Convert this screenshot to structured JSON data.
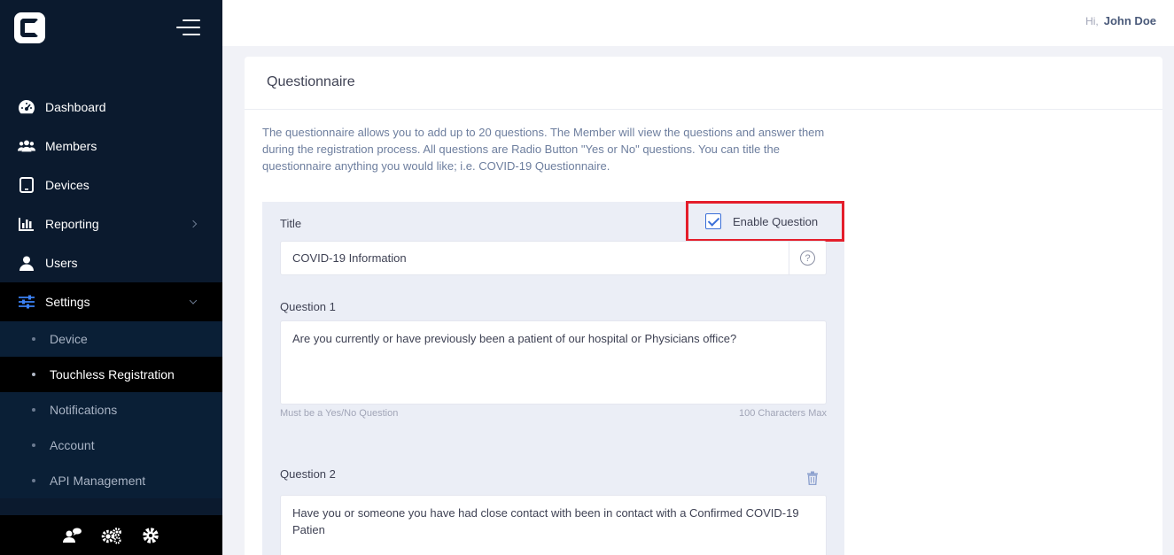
{
  "sidebar": {
    "nav": [
      {
        "label": "Dashboard",
        "icon": "dashboard-gauge-icon"
      },
      {
        "label": "Members",
        "icon": "members-group-icon"
      },
      {
        "label": "Devices",
        "icon": "tablet-device-icon"
      },
      {
        "label": "Reporting",
        "icon": "bar-chart-icon"
      },
      {
        "label": "Users",
        "icon": "user-icon"
      },
      {
        "label": "Settings",
        "icon": "sliders-icon"
      }
    ],
    "settings_sub": [
      {
        "label": "Device"
      },
      {
        "label": "Touchless Registration"
      },
      {
        "label": "Notifications"
      },
      {
        "label": "Account"
      },
      {
        "label": "API Management"
      }
    ],
    "active_sub": "Touchless Registration",
    "accent_color": "#3b82f6"
  },
  "topbar": {
    "greeting": "Hi,",
    "user_name": "John Doe"
  },
  "card": {
    "title": "Questionnaire",
    "description": "The questionnaire allows you to add up to 20 questions. The Member will view the questions and answer them during the registration process. All questions are Radio Button \"Yes or No\" questions. You can title the questionnaire anything you would like; i.e. COVID-19 Questionnaire."
  },
  "form": {
    "title_label": "Title",
    "enable_label": "Enable Question",
    "enable_checked": true,
    "title_value": "COVID-19 Information",
    "help_symbol": "?",
    "q1_label": "Question 1",
    "q1_value": "Are you currently or have previously been a patient of our hospital or Physicians office?",
    "q1_hint_left": "Must be a Yes/No Question",
    "q1_hint_right": "100 Characters Max",
    "q2_label": "Question 2",
    "q2_value": "Have you or someone you have had close contact with been in contact with a Confirmed COVID-19 Patien"
  },
  "colors": {
    "sidebar_bg": "#0b1a2e",
    "highlight_border": "#e41e2b",
    "checkbox": "#3b6fd8"
  }
}
